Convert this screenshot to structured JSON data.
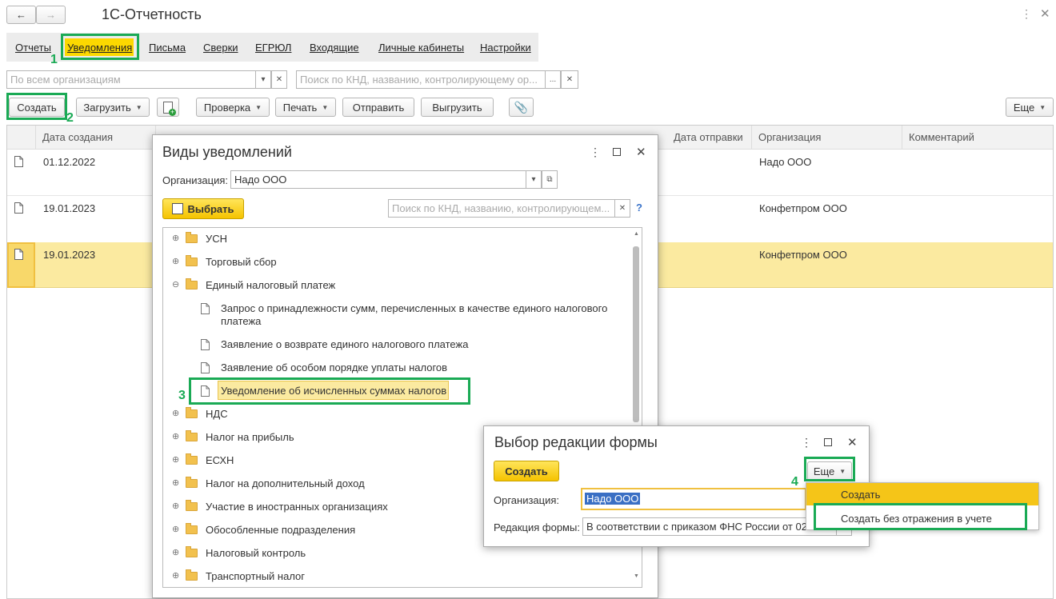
{
  "app": {
    "title": "1С-Отчетность"
  },
  "tabs": [
    "Отчеты",
    "Уведомления",
    "Письма",
    "Сверки",
    "ЕГРЮЛ",
    "Входящие",
    "Личные кабинеты",
    "Настройки"
  ],
  "filters": {
    "org_placeholder": "По всем организациям",
    "search_placeholder": "Поиск по КНД, названию, контролирующему ор..."
  },
  "toolbar": {
    "create": "Создать",
    "load": "Загрузить",
    "check": "Проверка",
    "print": "Печать",
    "send": "Отправить",
    "export": "Выгрузить",
    "more": "Еще"
  },
  "table": {
    "headers": {
      "date": "Дата создания",
      "sent": "Дата отправки",
      "org": "Организация",
      "comment": "Комментарий"
    },
    "rows": [
      {
        "date": "01.12.2022",
        "org": "Надо ООО"
      },
      {
        "date": "19.01.2023",
        "org": "Конфетпром ООО"
      },
      {
        "date": "19.01.2023",
        "org": "Конфетпром ООО"
      }
    ]
  },
  "kinds_dialog": {
    "title": "Виды уведомлений",
    "org_label": "Организация:",
    "org_value": "Надо ООО",
    "select_button": "Выбрать",
    "search_placeholder": "Поиск по КНД, названию, контролирующем...",
    "help": "?",
    "tree": [
      {
        "label": "УСН"
      },
      {
        "label": "Торговый сбор"
      },
      {
        "label": "Единый налоговый платеж"
      },
      {
        "label": "Запрос о принадлежности сумм, перечисленных в качестве единого налогового платежа"
      },
      {
        "label": "Заявление о возврате единого налогового платежа"
      },
      {
        "label": "Заявление об особом порядке уплаты налогов"
      },
      {
        "label": "Уведомление об исчисленных суммах налогов"
      },
      {
        "label": "НДС"
      },
      {
        "label": "Налог на прибыль"
      },
      {
        "label": "ЕСХН"
      },
      {
        "label": "Налог на дополнительный доход"
      },
      {
        "label": "Участие в иностранных организациях"
      },
      {
        "label": "Обособленные подразделения"
      },
      {
        "label": "Налоговый контроль"
      },
      {
        "label": "Транспортный налог"
      }
    ]
  },
  "edition_dialog": {
    "title": "Выбор редакции формы",
    "create_button": "Создать",
    "more_button": "Еще",
    "org_label": "Организация:",
    "org_value": "Надо ООО",
    "edition_label": "Редакция формы:",
    "edition_value": "В соответствии с приказом ФНС России от 02",
    "menu": {
      "create": "Создать",
      "create_no_accounting": "Создать без отражения в учете"
    }
  },
  "annotations": [
    "1",
    "2",
    "3",
    "4"
  ],
  "colors": {
    "accent_green": "#1aaa55",
    "selection_yellow": "#fbeaa0",
    "button_yellow": "#f5c300"
  }
}
